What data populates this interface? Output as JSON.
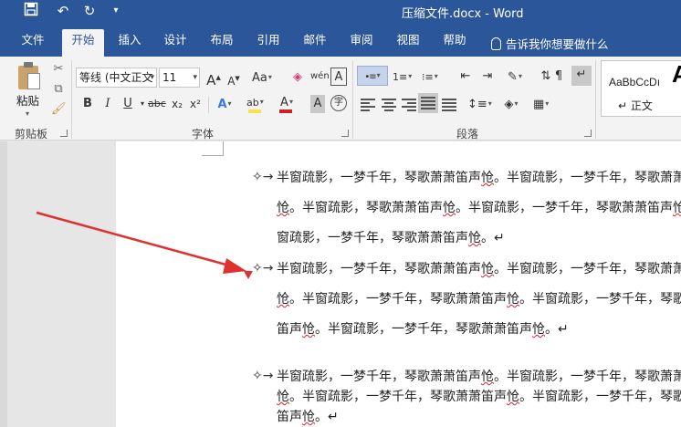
{
  "titlebar": {
    "title": "压缩文件.docx  -  Word",
    "save_icon": "💾",
    "undo_icon": "↶",
    "redo_icon": "↻",
    "customize_icon": "▾"
  },
  "tabs": [
    "文件",
    "开始",
    "插入",
    "设计",
    "布局",
    "引用",
    "邮件",
    "审阅",
    "视图",
    "帮助"
  ],
  "active_tab": "开始",
  "tellme": "告诉我你想要做什么",
  "ribbon": {
    "clipboard": {
      "paste_label": "粘贴",
      "group_label": "剪贴板"
    },
    "font": {
      "font_name": "等线 (中文正文",
      "font_size": "11",
      "grow": "A",
      "shrink": "A",
      "case": "Aa",
      "clear": "⌫",
      "phonetic": "wén",
      "border_char": "A",
      "bold": "B",
      "italic": "I",
      "underline": "U",
      "strike": "abc",
      "subscript": "x₂",
      "superscript": "x²",
      "effects": "A",
      "highlight": "ab",
      "font_color": "A",
      "shading": "A",
      "enclose": "字",
      "group_label": "字体"
    },
    "paragraph": {
      "group_label": "段落"
    },
    "styles": {
      "sample": "AaBbCcDı",
      "name": "↵ 正文",
      "big": "A"
    },
    "colors": {
      "highlight": "#f7e24a",
      "font_color": "#d11f1f",
      "shading_bar": "#333333"
    }
  },
  "document": {
    "bullet": "✧→",
    "paragraphs": [
      {
        "lines": [
          "半窗疏影，一梦千年，琴歌萧萧笛声怆。半窗疏影，一梦千年，琴歌萧萧笛声",
          "怆。半窗疏影，琴歌萧萧笛声怆。半窗疏影，一梦千年，琴歌萧萧笛声怆。半",
          "窗疏影，一梦千年，琴歌萧萧笛声怆。↵"
        ]
      },
      {
        "lines": [
          "半窗疏影，一梦千年，琴歌萧萧笛声怆。半窗疏影，一梦千年，琴歌萧萧笛声",
          "怆。半窗疏影，一梦千年，琴歌萧萧笛声怆。半窗疏影，一梦千年，琴歌萧萧",
          "笛声怆。半窗疏影，一梦千年，琴歌萧萧笛声怆。↵"
        ]
      },
      {
        "lines": [
          "半窗疏影，一梦千年，琴歌萧萧笛声怆。半窗疏影，一梦千年，琴歌萧萧笛声",
          "怆。半窗疏影，一梦千年，琴歌萧萧笛声怆。半窗疏影，一梦千年，琴歌萧萧",
          "笛声怆。↵"
        ]
      }
    ]
  },
  "annotation": {
    "arrow_color": "#e03030"
  }
}
